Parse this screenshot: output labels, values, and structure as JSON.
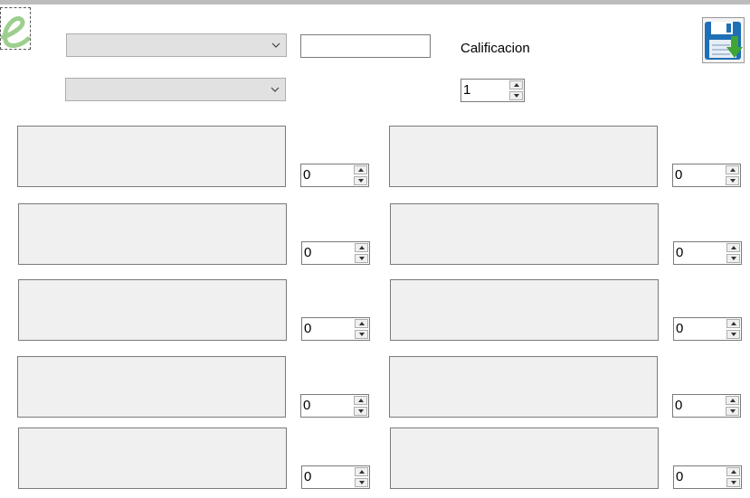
{
  "header": {
    "calificacion_label": "Calificacion",
    "calificacion_value": "1",
    "text_field_value": "",
    "combo1_value": "",
    "combo2_value": ""
  },
  "icons": {
    "logo": "e-logo-icon",
    "save": "save-disk-icon"
  },
  "colors": {
    "logo_green": "#9ccf8e",
    "save_blue": "#1e6fb5",
    "save_arrow_green": "#3fa535"
  },
  "items_left": [
    {
      "text": "",
      "value": "0"
    },
    {
      "text": "",
      "value": "0"
    },
    {
      "text": "",
      "value": "0"
    },
    {
      "text": "",
      "value": "0"
    },
    {
      "text": "",
      "value": "0"
    }
  ],
  "items_right": [
    {
      "text": "",
      "value": "0"
    },
    {
      "text": "",
      "value": "0"
    },
    {
      "text": "",
      "value": "0"
    },
    {
      "text": "",
      "value": "0"
    },
    {
      "text": "",
      "value": "0"
    }
  ]
}
